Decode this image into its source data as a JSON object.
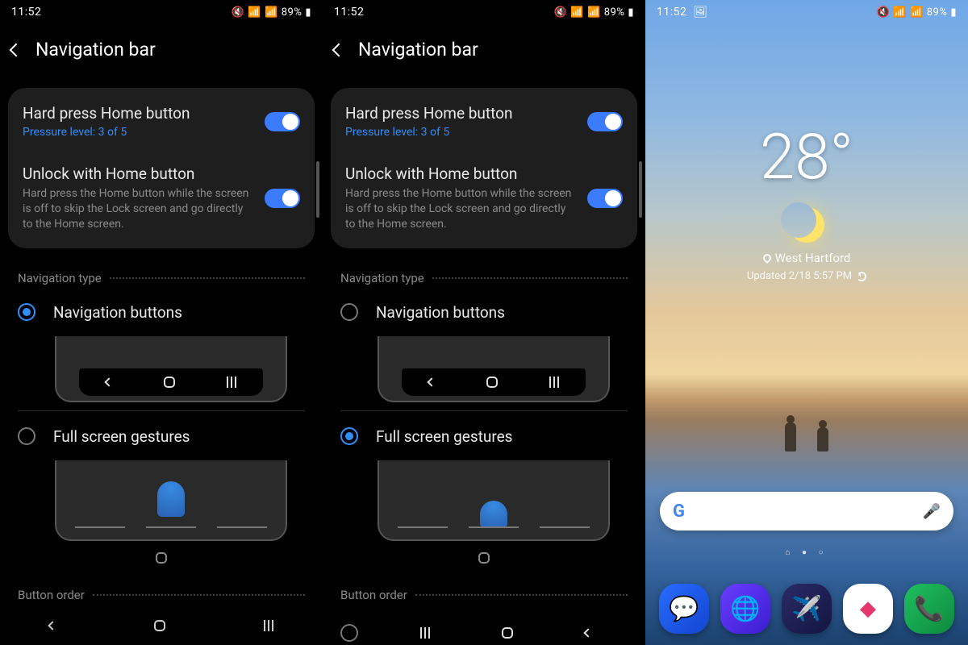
{
  "status": {
    "time": "11:52",
    "battery": "89%"
  },
  "settings": {
    "title": "Navigation bar",
    "hardPress": {
      "title": "Hard press Home button",
      "sub": "Pressure level: 3 of 5"
    },
    "unlock": {
      "title": "Unlock with Home button",
      "sub": "Hard press the Home button while the screen is off to skip the Lock screen and go directly to the Home screen."
    },
    "navType": {
      "label": "Navigation type",
      "opt1": "Navigation buttons",
      "opt2": "Full screen gestures"
    },
    "buttonOrder": {
      "label": "Button order"
    }
  },
  "home": {
    "temp": "28°",
    "location": "West Hartford",
    "updated": "Updated 2/18 5:57 PM"
  }
}
